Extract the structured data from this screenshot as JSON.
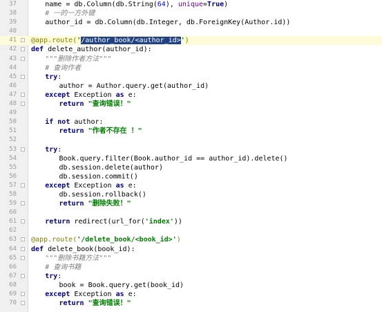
{
  "editor": {
    "highlight_line": "41",
    "lines": [
      {
        "num": "37",
        "indent": 4,
        "parts": [
          [
            "t",
            "name = db.Column(db.String("
          ],
          [
            "num",
            "64"
          ],
          [
            "t",
            "), "
          ],
          [
            "kwarg",
            "unique"
          ],
          [
            "t",
            "="
          ],
          [
            "kw",
            "True"
          ],
          [
            "t",
            ")"
          ]
        ]
      },
      {
        "num": "38",
        "indent": 4,
        "parts": [
          [
            "cmt",
            "# 一的一方外键"
          ]
        ]
      },
      {
        "num": "39",
        "indent": 4,
        "parts": [
          [
            "t",
            "author_id = db.Column(db.Integer, db.ForeignKey(Author.id))"
          ]
        ]
      },
      {
        "num": "40",
        "indent": 0,
        "parts": []
      },
      {
        "num": "41",
        "indent": 0,
        "parts": [
          [
            "dec",
            "@app.route("
          ],
          [
            "str",
            "'"
          ],
          [
            "sel",
            "/author_book/<author_id>"
          ],
          [
            "str",
            "'"
          ],
          [
            "dec",
            ")"
          ]
        ]
      },
      {
        "num": "42",
        "indent": 0,
        "parts": [
          [
            "kw",
            "def "
          ],
          [
            "t",
            "delete_author(author_id):"
          ]
        ]
      },
      {
        "num": "43",
        "indent": 4,
        "parts": [
          [
            "doc",
            "\"\"\"删除作者方法\"\"\""
          ]
        ]
      },
      {
        "num": "44",
        "indent": 4,
        "parts": [
          [
            "cmt",
            "# 查询作者"
          ]
        ]
      },
      {
        "num": "45",
        "indent": 4,
        "parts": [
          [
            "kw",
            "try"
          ],
          [
            "t",
            ":"
          ]
        ]
      },
      {
        "num": "46",
        "indent": 8,
        "parts": [
          [
            "t",
            "author = Author.query.get(author_id)"
          ]
        ]
      },
      {
        "num": "47",
        "indent": 4,
        "parts": [
          [
            "kw",
            "except "
          ],
          [
            "t",
            "Exception "
          ],
          [
            "kw",
            "as "
          ],
          [
            "t",
            "e:"
          ]
        ]
      },
      {
        "num": "48",
        "indent": 8,
        "parts": [
          [
            "kw",
            "return "
          ],
          [
            "str",
            "\"查询错误！\""
          ]
        ]
      },
      {
        "num": "49",
        "indent": 0,
        "parts": []
      },
      {
        "num": "50",
        "indent": 4,
        "parts": [
          [
            "kw",
            "if not "
          ],
          [
            "t",
            "author:"
          ]
        ]
      },
      {
        "num": "51",
        "indent": 8,
        "parts": [
          [
            "kw",
            "return "
          ],
          [
            "str",
            "\"作者不存在 ！\""
          ]
        ]
      },
      {
        "num": "52",
        "indent": 0,
        "parts": []
      },
      {
        "num": "53",
        "indent": 4,
        "parts": [
          [
            "kw",
            "try"
          ],
          [
            "t",
            ":"
          ]
        ]
      },
      {
        "num": "54",
        "indent": 8,
        "parts": [
          [
            "t",
            "Book.query.filter(Book.author_id == author_id).delete()"
          ]
        ]
      },
      {
        "num": "55",
        "indent": 8,
        "parts": [
          [
            "t",
            "db.session.delete(author)"
          ]
        ]
      },
      {
        "num": "56",
        "indent": 8,
        "parts": [
          [
            "t",
            "db.session.commit()"
          ]
        ]
      },
      {
        "num": "57",
        "indent": 4,
        "parts": [
          [
            "kw",
            "except "
          ],
          [
            "t",
            "Exception "
          ],
          [
            "kw",
            "as "
          ],
          [
            "t",
            "e:"
          ]
        ]
      },
      {
        "num": "58",
        "indent": 8,
        "parts": [
          [
            "t",
            "db.session.rollback()"
          ]
        ]
      },
      {
        "num": "59",
        "indent": 8,
        "parts": [
          [
            "kw",
            "return "
          ],
          [
            "str",
            "\"删除失败！\""
          ]
        ]
      },
      {
        "num": "60",
        "indent": 0,
        "parts": []
      },
      {
        "num": "61",
        "indent": 4,
        "parts": [
          [
            "kw",
            "return "
          ],
          [
            "t",
            "redirect(url_for("
          ],
          [
            "str",
            "'index'"
          ],
          [
            "t",
            "))"
          ]
        ]
      },
      {
        "num": "62",
        "indent": 0,
        "parts": []
      },
      {
        "num": "63",
        "indent": 0,
        "parts": [
          [
            "dec",
            "@app.route("
          ],
          [
            "str",
            "'/delete_book/<book_id>'"
          ],
          [
            "dec",
            ")"
          ]
        ]
      },
      {
        "num": "64",
        "indent": 0,
        "parts": [
          [
            "kw",
            "def "
          ],
          [
            "t",
            "delete_book(book_id):"
          ]
        ]
      },
      {
        "num": "65",
        "indent": 4,
        "parts": [
          [
            "doc",
            "\"\"\"删除书籍方法\"\"\""
          ]
        ]
      },
      {
        "num": "66",
        "indent": 4,
        "parts": [
          [
            "cmt",
            "# 查询书籍"
          ]
        ]
      },
      {
        "num": "67",
        "indent": 4,
        "parts": [
          [
            "kw",
            "try"
          ],
          [
            "t",
            ":"
          ]
        ]
      },
      {
        "num": "68",
        "indent": 8,
        "parts": [
          [
            "t",
            "book = Book.query.get(book_id)"
          ]
        ]
      },
      {
        "num": "69",
        "indent": 4,
        "parts": [
          [
            "kw",
            "except "
          ],
          [
            "t",
            "Exception "
          ],
          [
            "kw",
            "as "
          ],
          [
            "t",
            "e:"
          ]
        ]
      },
      {
        "num": "70",
        "indent": 8,
        "parts": [
          [
            "kw",
            "return "
          ],
          [
            "str",
            "\"查询错误！\""
          ]
        ]
      }
    ]
  },
  "colors": {
    "keyword": "#000080",
    "string": "#008000",
    "decorator": "#808000",
    "comment": "#808080",
    "selection": "#214283",
    "current_line": "#fefbd8"
  }
}
